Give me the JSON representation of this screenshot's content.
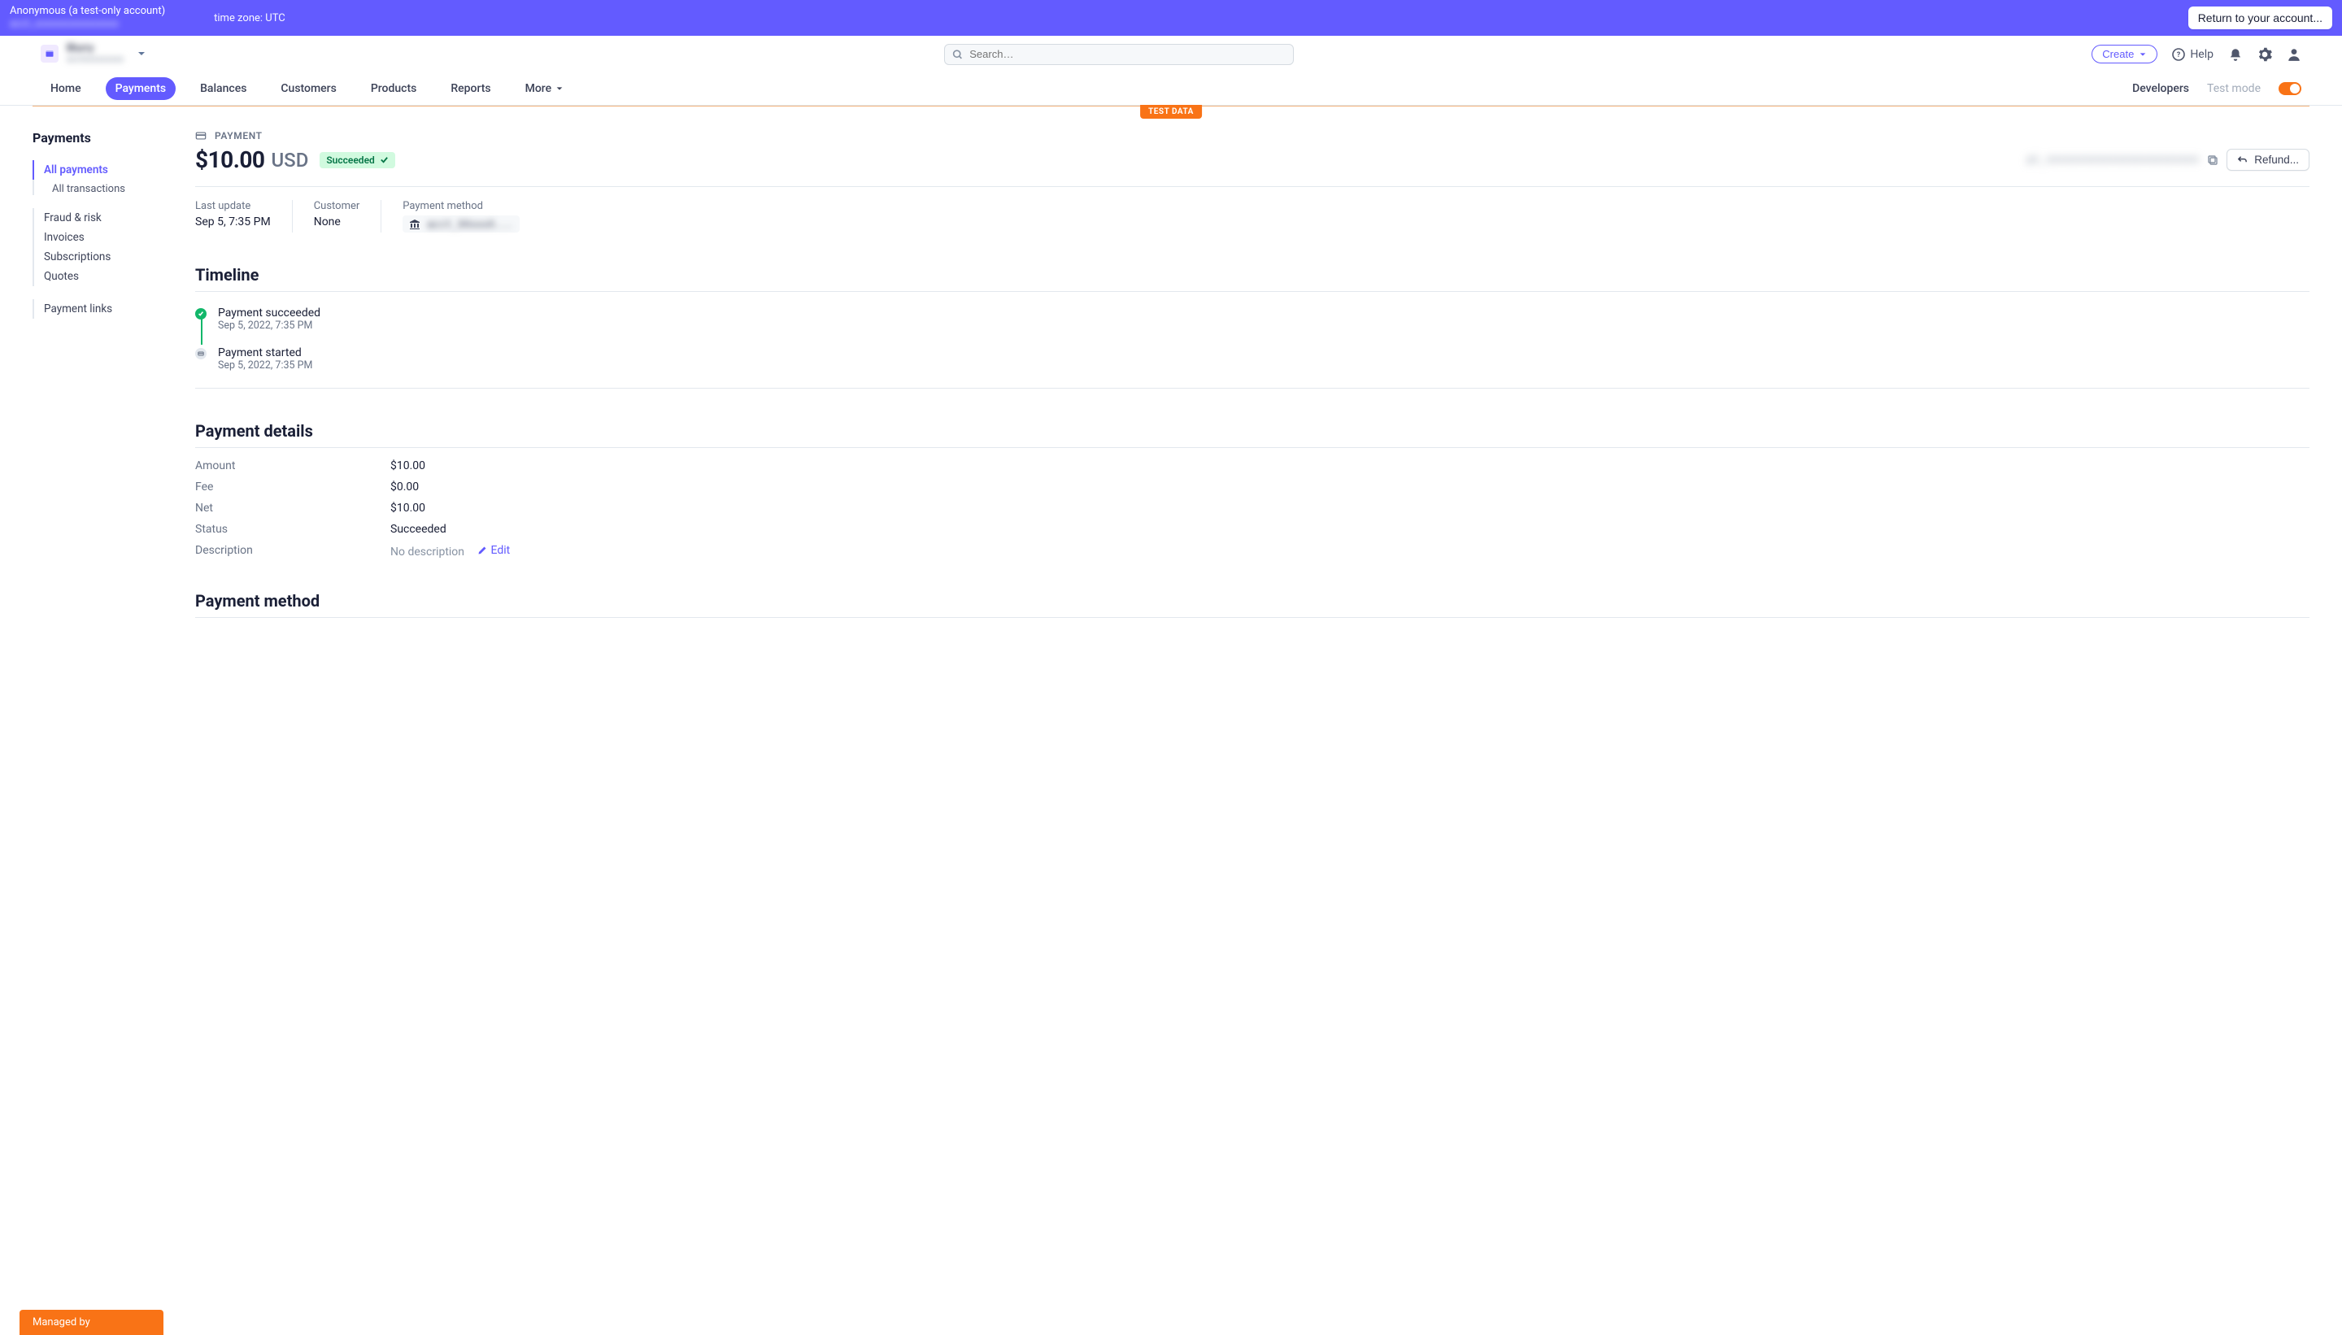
{
  "impersonate": {
    "who": "Anonymous (a test-only account)",
    "acct_id": "acct_xxxxxxxxxxxxxxxx",
    "timezone_label": "time zone: UTC",
    "return_btn": "Return to your account..."
  },
  "header": {
    "account_name": "Blurry",
    "account_sub": "acctxxxxxxxxx",
    "search_placeholder": "Search…",
    "create": "Create",
    "help": "Help",
    "developers": "Developers",
    "test_mode": "Test mode",
    "test_mode_on": true,
    "nav": [
      "Home",
      "Payments",
      "Balances",
      "Customers",
      "Products",
      "Reports",
      "More"
    ],
    "nav_active": "Payments",
    "test_data_badge": "TEST DATA"
  },
  "sidebar": {
    "title": "Payments",
    "groups": [
      {
        "items": [
          {
            "label": "All payments",
            "active": true
          },
          {
            "label": "All transactions",
            "indent": true
          }
        ]
      },
      {
        "items": [
          {
            "label": "Fraud & risk"
          },
          {
            "label": "Invoices"
          },
          {
            "label": "Subscriptions"
          },
          {
            "label": "Quotes"
          }
        ]
      },
      {
        "items": [
          {
            "label": "Payment links"
          }
        ]
      }
    ]
  },
  "payment": {
    "kicker": "PAYMENT",
    "amount": "$10.00",
    "currency": "USD",
    "status_label": "Succeeded",
    "id_blurred": "pi_xxxxxxxxxxxxxxxxxxxxxxxx",
    "refund_btn": "Refund...",
    "summary": {
      "last_update_label": "Last update",
      "last_update": "Sep 5, 7:35 PM",
      "customer_label": "Customer",
      "customer": "None",
      "pm_label": "Payment method",
      "pm_value_blurred": "acct_XXxxxX..."
    }
  },
  "timeline": {
    "title": "Timeline",
    "items": [
      {
        "dot": "ok",
        "title": "Payment succeeded",
        "ts": "Sep 5, 2022, 7:35 PM"
      },
      {
        "dot": "card",
        "title": "Payment started",
        "ts": "Sep 5, 2022, 7:35 PM"
      }
    ]
  },
  "details": {
    "title": "Payment details",
    "rows": {
      "amount_k": "Amount",
      "amount_v": "$10.00",
      "fee_k": "Fee",
      "fee_v": "$0.00",
      "net_k": "Net",
      "net_v": "$10.00",
      "status_k": "Status",
      "status_v": "Succeeded",
      "desc_k": "Description",
      "desc_v": "No description",
      "edit": "Edit"
    }
  },
  "pm_section": {
    "title": "Payment method"
  },
  "managed_by": "Managed by"
}
